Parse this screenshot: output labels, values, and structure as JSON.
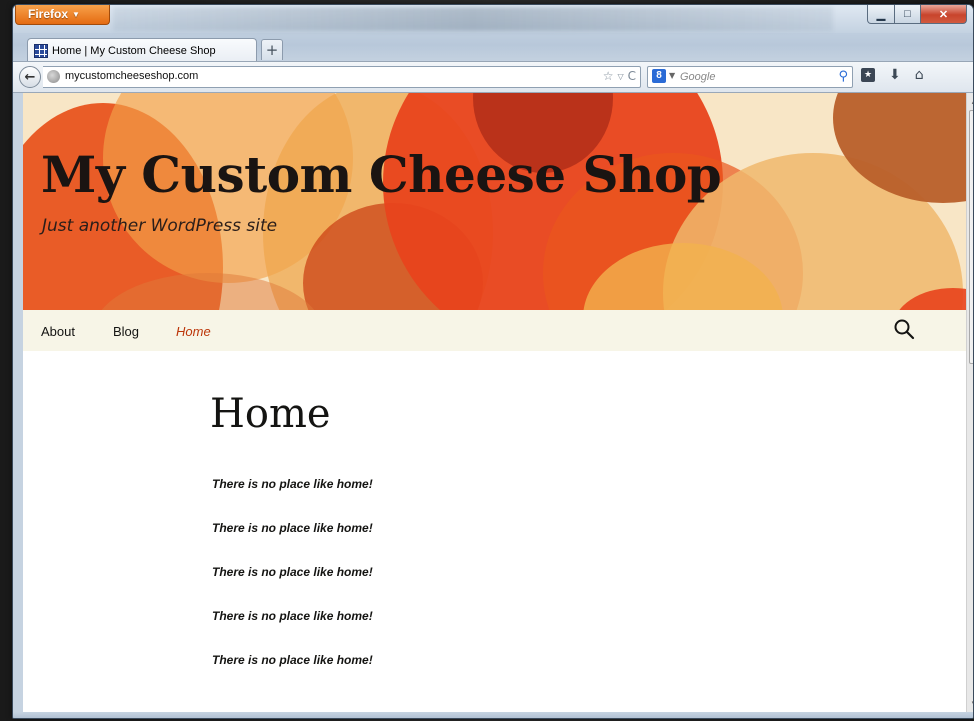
{
  "browser": {
    "app_button": "Firefox",
    "tab_title": "Home | My Custom Cheese Shop",
    "url": "mycustomcheeseshop.com",
    "search_placeholder": "Google",
    "window_controls": [
      "minimize-icon",
      "maximize-icon",
      "close-icon"
    ]
  },
  "site": {
    "title": "My Custom Cheese Shop",
    "description": "Just another WordPress site",
    "nav": [
      {
        "label": "About",
        "current": false
      },
      {
        "label": "Blog",
        "current": false
      },
      {
        "label": "Home",
        "current": true
      }
    ]
  },
  "page": {
    "title": "Home",
    "paragraphs": [
      "There is no place like home!",
      "There is no place like home!",
      "There is no place like home!",
      "There is no place like home!",
      "There is no place like home!"
    ]
  },
  "colors": {
    "accent_current_nav": "#bc360a",
    "nav_background": "#f7f5e7",
    "header_orange": "#e8541f",
    "header_cream": "#f8e6c6"
  },
  "icons": {
    "back": "back-arrow-icon",
    "globe": "globe-icon",
    "star": "star-icon",
    "reload": "reload-icon",
    "search": "search-icon",
    "bookmarks": "bookmarks-icon",
    "downloads": "download-icon",
    "home": "home-icon"
  }
}
